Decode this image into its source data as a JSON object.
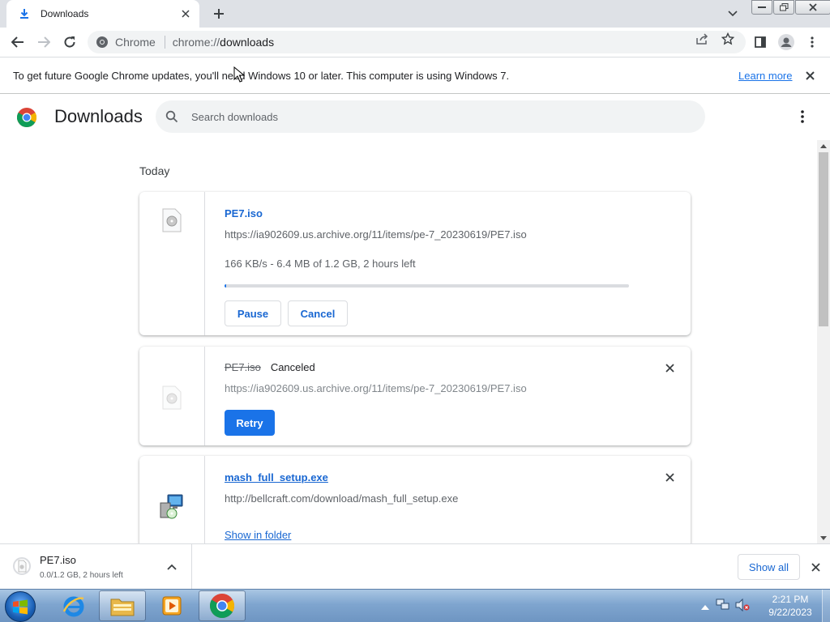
{
  "tab": {
    "title": "Downloads",
    "icon": "download-icon"
  },
  "omnibox": {
    "scheme_label": "Chrome",
    "url_prefix": "chrome://",
    "url_host": "downloads"
  },
  "infobar": {
    "message": "To get future Google Chrome updates, you'll need Windows 10 or later. This computer is using Windows 7.",
    "learn_more": "Learn more"
  },
  "page": {
    "title": "Downloads",
    "search_placeholder": "Search downloads",
    "section_date": "Today"
  },
  "downloads": [
    {
      "file_name": "PE7.iso",
      "url": "https://ia902609.us.archive.org/11/items/pe-7_20230619/PE7.iso",
      "progress_text": "166 KB/s - 6.4 MB of 1.2 GB, 2 hours left",
      "progress_percent": 0.5,
      "pause_label": "Pause",
      "cancel_label": "Cancel"
    },
    {
      "file_name": "PE7.iso",
      "status": "Canceled",
      "url": "https://ia902609.us.archive.org/11/items/pe-7_20230619/PE7.iso",
      "retry_label": "Retry"
    },
    {
      "file_name": "mash_full_setup.exe",
      "url": "http://bellcraft.com/download/mash_full_setup.exe",
      "show_in_folder_label": "Show in folder"
    }
  ],
  "shelf": {
    "file_name": "PE7.iso",
    "status": "0.0/1.2 GB, 2 hours left",
    "show_all_label": "Show all"
  },
  "taskbar": {
    "time": "2:21 PM",
    "date": "9/22/2023",
    "apps": [
      "internet-explorer-icon",
      "file-explorer-icon",
      "media-player-icon",
      "chrome-icon"
    ]
  },
  "colors": {
    "accent": "#1a73e8",
    "link": "#1967d2",
    "taskbar": "#7fa5cf"
  }
}
